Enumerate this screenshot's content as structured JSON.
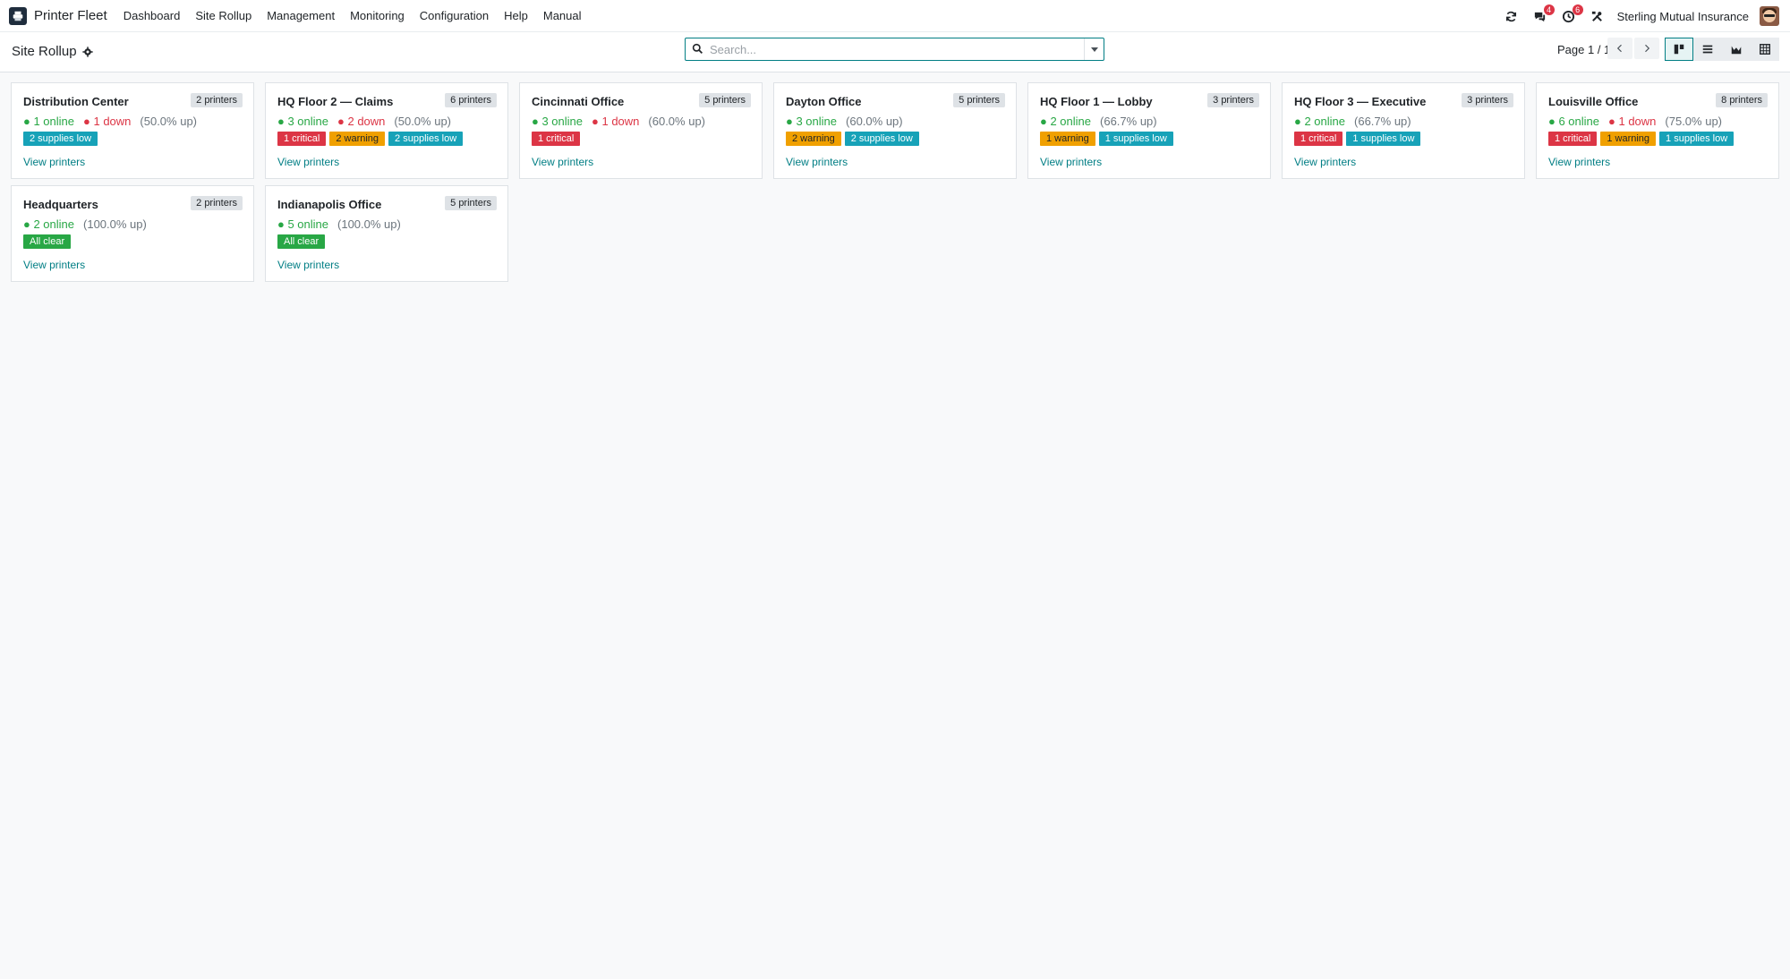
{
  "navbar": {
    "brand": "Printer Fleet",
    "menu": [
      "Dashboard",
      "Site Rollup",
      "Management",
      "Monitoring",
      "Configuration",
      "Help",
      "Manual"
    ],
    "messages_badge": "4",
    "activities_badge": "6",
    "company": "Sterling Mutual Insurance"
  },
  "control": {
    "title": "Site Rollup",
    "search_placeholder": "Search...",
    "pager": "Page 1 / 1"
  },
  "colors": {
    "accent": "#017e84",
    "online": "#28a745",
    "down": "#dc3545",
    "critical": "#dc3545",
    "warning": "#f0a000",
    "supplies": "#17a2b8",
    "clear": "#28a745"
  },
  "sites": [
    {
      "name": "Distribution Center",
      "count": "2 printers",
      "online": "● 1 online",
      "down": "● 1 down",
      "uptime": "(50.0% up)",
      "tags": [
        {
          "kind": "supplies",
          "label": "2 supplies low"
        }
      ],
      "link": "View printers"
    },
    {
      "name": "HQ Floor 2 — Claims",
      "count": "6 printers",
      "online": "● 3 online",
      "down": "● 2 down",
      "uptime": "(50.0% up)",
      "tags": [
        {
          "kind": "critical",
          "label": "1 critical"
        },
        {
          "kind": "warning",
          "label": "2 warning"
        },
        {
          "kind": "supplies",
          "label": "2 supplies low"
        }
      ],
      "link": "View printers"
    },
    {
      "name": "Cincinnati Office",
      "count": "5 printers",
      "online": "● 3 online",
      "down": "● 1 down",
      "uptime": "(60.0% up)",
      "tags": [
        {
          "kind": "critical",
          "label": "1 critical"
        }
      ],
      "link": "View printers"
    },
    {
      "name": "Dayton Office",
      "count": "5 printers",
      "online": "● 3 online",
      "down": "",
      "uptime": "(60.0% up)",
      "tags": [
        {
          "kind": "warning",
          "label": "2 warning"
        },
        {
          "kind": "supplies",
          "label": "2 supplies low"
        }
      ],
      "link": "View printers"
    },
    {
      "name": "HQ Floor 1 — Lobby",
      "count": "3 printers",
      "online": "● 2 online",
      "down": "",
      "uptime": "(66.7% up)",
      "tags": [
        {
          "kind": "warning",
          "label": "1 warning"
        },
        {
          "kind": "supplies",
          "label": "1 supplies low"
        }
      ],
      "link": "View printers"
    },
    {
      "name": "HQ Floor 3 — Executive",
      "count": "3 printers",
      "online": "● 2 online",
      "down": "",
      "uptime": "(66.7% up)",
      "tags": [
        {
          "kind": "critical",
          "label": "1 critical"
        },
        {
          "kind": "supplies",
          "label": "1 supplies low"
        }
      ],
      "link": "View printers"
    },
    {
      "name": "Louisville Office",
      "count": "8 printers",
      "online": "● 6 online",
      "down": "● 1 down",
      "uptime": "(75.0% up)",
      "tags": [
        {
          "kind": "critical",
          "label": "1 critical"
        },
        {
          "kind": "warning",
          "label": "1 warning"
        },
        {
          "kind": "supplies",
          "label": "1 supplies low"
        }
      ],
      "link": "View printers"
    },
    {
      "name": "Headquarters",
      "count": "2 printers",
      "online": "● 2 online",
      "down": "",
      "uptime": "(100.0% up)",
      "tags": [
        {
          "kind": "clear",
          "label": "All clear"
        }
      ],
      "link": "View printers"
    },
    {
      "name": "Indianapolis Office",
      "count": "5 printers",
      "online": "● 5 online",
      "down": "",
      "uptime": "(100.0% up)",
      "tags": [
        {
          "kind": "clear",
          "label": "All clear"
        }
      ],
      "link": "View printers"
    }
  ]
}
